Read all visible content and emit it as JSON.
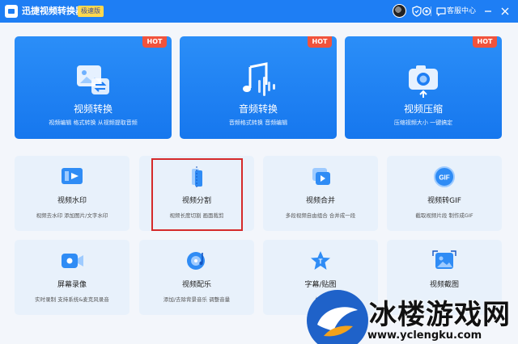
{
  "titlebar": {
    "app_title": "迅捷视频转换器",
    "edition": "极速版",
    "support_label": "客服中心",
    "icons": [
      "avatar",
      "shield-icon",
      "settings-icon",
      "chat-icon",
      "minimize-icon",
      "close-icon"
    ]
  },
  "big_cards": [
    {
      "title": "视频转换",
      "subtitle": "视频编辑 格式转换 从视频提取音频",
      "badge": "HOT",
      "icon": "video-convert-icon"
    },
    {
      "title": "音频转换",
      "subtitle": "音频格式转换  音频编辑",
      "badge": "HOT",
      "icon": "music-note-icon"
    },
    {
      "title": "视频压缩",
      "subtitle": "压缩视频大小 一键搞定",
      "badge": "HOT",
      "icon": "camera-compress-icon"
    }
  ],
  "small_cards": [
    {
      "title": "视频水印",
      "subtitle": "视频去水印 添加图片/文字水印",
      "icon": "watermark-icon"
    },
    {
      "title": "视频分割",
      "subtitle": "视频长度切割 画面裁剪",
      "icon": "split-icon"
    },
    {
      "title": "视频合并",
      "subtitle": "多段视频自由组合 合并成一段",
      "icon": "merge-icon"
    },
    {
      "title": "视频转GIF",
      "subtitle": "截取视频片段 制作成GIF",
      "icon": "gif-icon"
    },
    {
      "title": "屏幕录像",
      "subtitle": "实时录制 支持系统&麦克风录音",
      "icon": "screen-record-icon"
    },
    {
      "title": "视频配乐",
      "subtitle": "添加/去除背景音乐 调整音量",
      "icon": "music-disc-icon"
    },
    {
      "title": "字幕/贴图",
      "subtitle": "视频",
      "icon": "subtitle-icon"
    },
    {
      "title": "视频截图",
      "subtitle": "",
      "icon": "screenshot-icon"
    }
  ],
  "watermark": {
    "text": "冰楼游戏网",
    "url": "www.yclengku.com"
  },
  "colors": {
    "titlebar": "#1e7ef4",
    "card_blue": "#1677ee",
    "hot_red": "#f1533c",
    "small_card_bg": "#e8f1fb",
    "highlight_red": "#d52a2a"
  }
}
